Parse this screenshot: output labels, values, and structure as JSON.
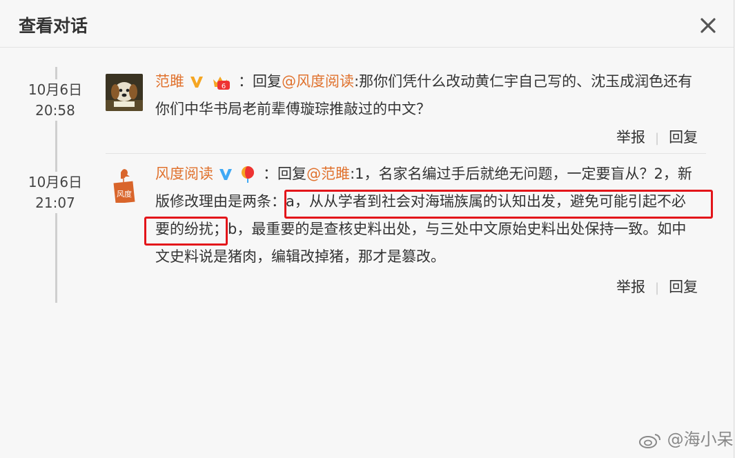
{
  "header": {
    "title": "查看对话"
  },
  "comments": [
    {
      "date": "10月6日",
      "time": "20:58",
      "username": "范雎",
      "after_user": "：回复",
      "mention": "@风度阅读",
      "text_line1": ":那你们凭什么改动黄仁宇自己写的、沈玉成润色还有",
      "text_line2": "你们中华书局老前辈傅璇琮推敲过的中文？",
      "report": "举报",
      "reply": "回复"
    },
    {
      "date": "10月6日",
      "time": "21:07",
      "username": "风度阅读",
      "after_user": "：回复",
      "mention": "@范雎",
      "text_line1": ":1，名家名编过手后就绝无问题，一定要盲从？2，新",
      "text_line2": "版修改理由是两条：a，从从学者到社会对海瑞族属的认知出发，避免可能引起不必",
      "text_line3": "要的纷扰；b，最重要的是查核史料出处，与三处中文原始史料出处保持一致。如中",
      "text_line4": "文史料说是猪肉，编辑改掉猪，那才是篡改。",
      "report": "举报",
      "reply": "回复",
      "avatar_text": "风度"
    }
  ],
  "watermark": "@海小呆",
  "colors": {
    "username": "#e0722e",
    "highlight": "#e3151a",
    "verified": "#f5a623",
    "verified_blue": "#3fa9f5"
  }
}
